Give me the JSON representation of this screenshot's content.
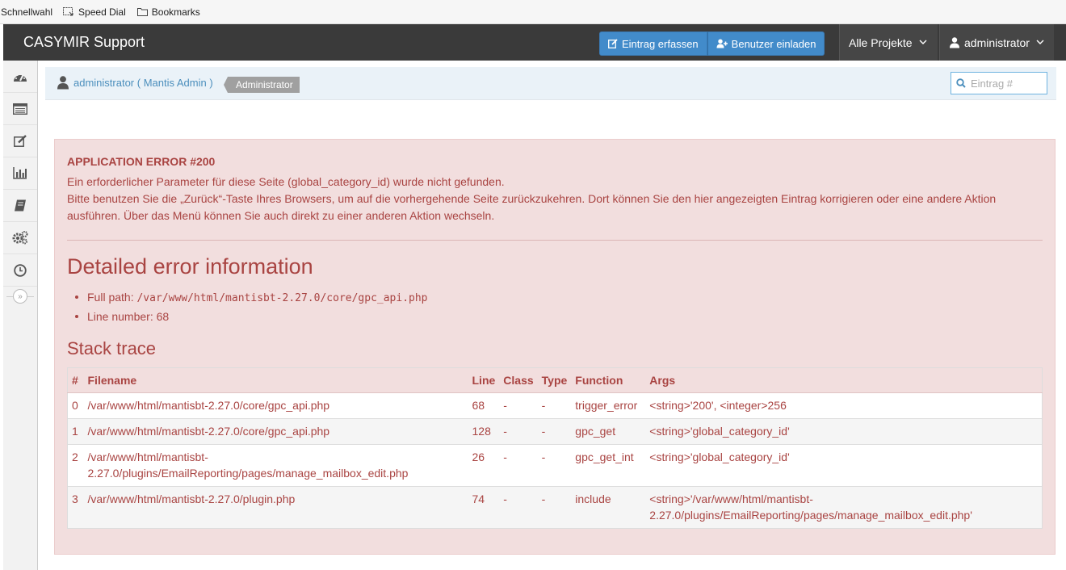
{
  "bookmarks": {
    "items": [
      "Schnellwahl",
      "Speed Dial",
      "Bookmarks"
    ]
  },
  "navbar": {
    "brand": "CASYMIR Support",
    "report_button": "Eintrag erfassen",
    "invite_button": "Benutzer einladen",
    "projects_dropdown": "Alle Projekte",
    "user_dropdown": "administrator"
  },
  "sidebar": {
    "icons": [
      "dashboard-icon",
      "view-issues-icon",
      "report-issue-icon",
      "summary-icon",
      "changelog-icon",
      "manage-icon",
      "timeline-icon"
    ]
  },
  "breadcrumb": {
    "user": "administrator ( Mantis Admin )",
    "access_level": "Administrator",
    "search_placeholder": "Eintrag #"
  },
  "error": {
    "title": "APPLICATION ERROR #200",
    "message_1": "Ein erforderlicher Parameter für diese Seite (global_category_id) wurde nicht gefunden.",
    "message_2": "Bitte benutzen Sie die „Zurück“-Taste Ihres Browsers, um auf die vorhergehende Seite zurückzukehren. Dort können Sie den hier angezeigten Eintrag korrigieren oder eine andere Aktion ausführen. Über das Menü können Sie auch direkt zu einer anderen Aktion wechseln.",
    "detail_heading": "Detailed error information",
    "full_path_label": "Full path:",
    "full_path_value": "/var/www/html/mantisbt-2.27.0/core/gpc_api.php",
    "line_number_label": "Line number:",
    "line_number_value": "68",
    "stack_heading": "Stack trace"
  },
  "stack_table": {
    "headers": [
      "#",
      "Filename",
      "Line",
      "Class",
      "Type",
      "Function",
      "Args"
    ],
    "rows": [
      [
        "0",
        "/var/www/html/mantisbt-2.27.0/core/gpc_api.php",
        "68",
        "-",
        "-",
        "trigger_error",
        "<string>'200', <integer>256"
      ],
      [
        "1",
        "/var/www/html/mantisbt-2.27.0/core/gpc_api.php",
        "128",
        "-",
        "-",
        "gpc_get",
        "<string>'global_category_id'"
      ],
      [
        "2",
        "/var/www/html/mantisbt-2.27.0/plugins/EmailReporting/pages/manage_mailbox_edit.php",
        "26",
        "-",
        "-",
        "gpc_get_int",
        "<string>'global_category_id'"
      ],
      [
        "3",
        "/var/www/html/mantisbt-2.27.0/plugin.php",
        "74",
        "-",
        "-",
        "include",
        "<string>'/var/www/html/mantisbt-2.27.0/plugins/EmailReporting/pages/manage_mailbox_edit.php'"
      ]
    ]
  }
}
